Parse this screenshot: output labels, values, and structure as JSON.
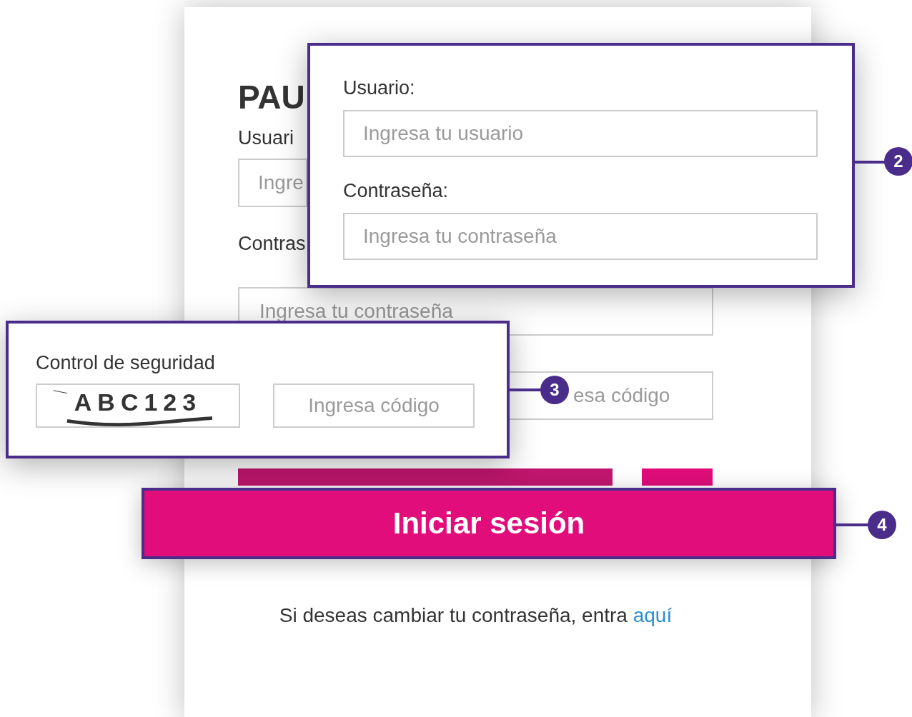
{
  "page": {
    "title": "PAU",
    "username_label": "Usuari",
    "username_placeholder": "Ingre",
    "password_label": "Contras",
    "password_placeholder": "Ingresa tu contraseña",
    "code_placeholder": "esa código",
    "footer_text": "Si deseas cambiar tu contraseña, entra",
    "footer_link": "aquí"
  },
  "callouts": [
    {
      "kind": "credentials",
      "badge": "2",
      "username_label": "Usuario:",
      "username_placeholder": "Ingresa tu usuario",
      "password_label": "Contraseña:",
      "password_placeholder": "Ingresa tu contraseña"
    },
    {
      "kind": "captcha",
      "badge": "3",
      "label": "Control de seguridad",
      "captcha": "ABC123",
      "code_placeholder": "Ingresa código"
    },
    {
      "kind": "button",
      "badge": "4",
      "label": "Iniciar sesión"
    }
  ]
}
